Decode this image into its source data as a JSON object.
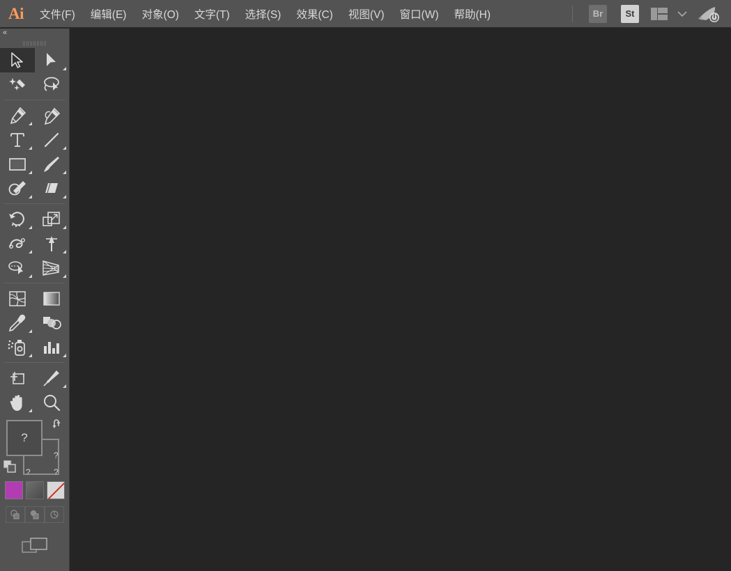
{
  "app": {
    "name": "Adobe Illustrator",
    "logo_text": "Ai",
    "logo_color": "#ff9a5c"
  },
  "menubar": {
    "items": [
      {
        "label": "文件(F)",
        "name": "menu-file"
      },
      {
        "label": "编辑(E)",
        "name": "menu-edit"
      },
      {
        "label": "对象(O)",
        "name": "menu-object"
      },
      {
        "label": "文字(T)",
        "name": "menu-type"
      },
      {
        "label": "选择(S)",
        "name": "menu-select"
      },
      {
        "label": "效果(C)",
        "name": "menu-effect"
      },
      {
        "label": "视图(V)",
        "name": "menu-view"
      },
      {
        "label": "窗口(W)",
        "name": "menu-window"
      },
      {
        "label": "帮助(H)",
        "name": "menu-help"
      }
    ],
    "right": {
      "bridge_label": "Br",
      "stock_label": "St",
      "workspace_icon": "workspace-layout-icon",
      "chevron_icon": "chevron-down-icon",
      "rocket_icon": "rocket-power-icon"
    }
  },
  "toolpanel": {
    "collapse_label": "«",
    "grip": "panel-grip",
    "groups": [
      {
        "tools": [
          {
            "name": "selection-tool",
            "icon": "arrow-solid-cursor",
            "active": true,
            "corner": false
          },
          {
            "name": "direct-selection-tool",
            "icon": "arrow-filled-cursor",
            "active": false,
            "corner": true
          },
          {
            "name": "magic-wand-tool",
            "icon": "magic-wand",
            "active": false,
            "corner": false
          },
          {
            "name": "lasso-tool",
            "icon": "lasso",
            "active": false,
            "corner": false
          }
        ]
      },
      {
        "tools": [
          {
            "name": "pen-tool",
            "icon": "pen-nib",
            "active": false,
            "corner": true
          },
          {
            "name": "curvature-tool",
            "icon": "curvature-pen",
            "active": false,
            "corner": false
          },
          {
            "name": "type-tool",
            "icon": "type-T",
            "active": false,
            "corner": true
          },
          {
            "name": "line-segment-tool",
            "icon": "line-segment",
            "active": false,
            "corner": true
          },
          {
            "name": "rectangle-tool",
            "icon": "rectangle",
            "active": false,
            "corner": true
          },
          {
            "name": "paintbrush-tool",
            "icon": "paintbrush",
            "active": false,
            "corner": true
          },
          {
            "name": "shaper-tool",
            "icon": "shaper-pencil",
            "active": false,
            "corner": true
          },
          {
            "name": "eraser-tool",
            "icon": "eraser",
            "active": false,
            "corner": true
          }
        ]
      },
      {
        "tools": [
          {
            "name": "rotate-tool",
            "icon": "rotate",
            "active": false,
            "corner": true
          },
          {
            "name": "scale-tool",
            "icon": "scale",
            "active": false,
            "corner": true
          },
          {
            "name": "width-tool",
            "icon": "width-warp",
            "active": false,
            "corner": true
          },
          {
            "name": "free-transform-tool",
            "icon": "free-transform",
            "active": false,
            "corner": true
          },
          {
            "name": "shape-builder-tool",
            "icon": "shape-builder",
            "active": false,
            "corner": true
          },
          {
            "name": "perspective-grid-tool",
            "icon": "perspective-grid",
            "active": false,
            "corner": true
          }
        ]
      },
      {
        "tools": [
          {
            "name": "mesh-tool",
            "icon": "mesh",
            "active": false,
            "corner": false
          },
          {
            "name": "gradient-tool",
            "icon": "gradient",
            "active": false,
            "corner": false
          },
          {
            "name": "eyedropper-tool",
            "icon": "eyedropper",
            "active": false,
            "corner": true
          },
          {
            "name": "blend-tool",
            "icon": "blend",
            "active": false,
            "corner": false
          },
          {
            "name": "symbol-sprayer-tool",
            "icon": "symbol-sprayer",
            "active": false,
            "corner": true
          },
          {
            "name": "column-graph-tool",
            "icon": "bar-graph",
            "active": false,
            "corner": true
          }
        ]
      },
      {
        "tools": [
          {
            "name": "artboard-tool",
            "icon": "artboard",
            "active": false,
            "corner": false
          },
          {
            "name": "slice-tool",
            "icon": "slice-knife",
            "active": false,
            "corner": true
          },
          {
            "name": "hand-tool",
            "icon": "hand",
            "active": false,
            "corner": true
          },
          {
            "name": "zoom-tool",
            "icon": "magnifier",
            "active": false,
            "corner": false
          }
        ]
      }
    ],
    "fillstroke": {
      "fill_label": "?",
      "stroke_label": "?",
      "swap_icon": "swap-fill-stroke-icon",
      "default_icon": "default-fill-stroke-icon",
      "q_marks": [
        "?",
        "?",
        "?"
      ]
    },
    "colormodes": [
      {
        "name": "color-swatch",
        "label": "",
        "color": "#b23cb2"
      },
      {
        "name": "gradient-swatch",
        "label": "",
        "color": "#5c5c5c"
      },
      {
        "name": "none-swatch",
        "label": "",
        "color": "#d8d8d8"
      }
    ],
    "drawmodes": [
      {
        "name": "draw-normal-mode",
        "icon": "draw-normal-icon"
      },
      {
        "name": "draw-behind-mode",
        "icon": "draw-behind-icon"
      },
      {
        "name": "draw-inside-mode",
        "icon": "draw-inside-icon"
      }
    ],
    "screenmode": {
      "name": "change-screen-mode",
      "icon": "screen-mode-icon"
    }
  },
  "canvas": {
    "background_color": "#252525",
    "content": ""
  },
  "colors": {
    "panel_bg": "#535353",
    "canvas_bg": "#252525",
    "menu_bg": "#535353",
    "text": "#d8d8d8",
    "icon": "#d6d6d6",
    "accent": "#ff9a5c",
    "active_tool_bg": "#323232"
  }
}
